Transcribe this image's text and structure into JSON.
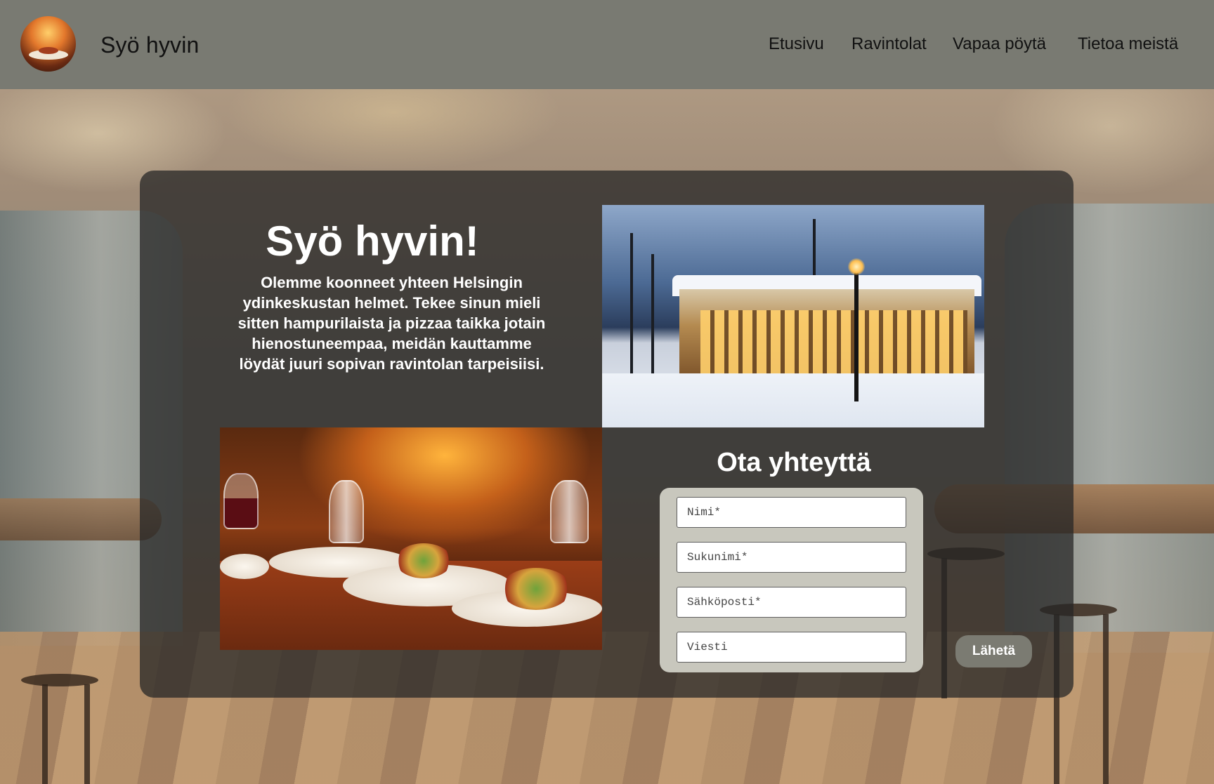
{
  "header": {
    "brand": "Syö hyvin",
    "nav": [
      {
        "label": "Etusivu"
      },
      {
        "label": "Ravintolat"
      },
      {
        "label": "Vapaa pöytä"
      },
      {
        "label": "Tietoa meistä"
      }
    ]
  },
  "hero": {
    "title": "Syö hyvin!",
    "text": "Olemme koonneet yhteen Helsingin ydinkeskustan helmet. Tekee sinun mieli sitten hampurilaista ja pizzaa taikka jotain hienostuneempaa, meidän kauttamme löydät juuri sopivan ravintolan tarpeisiisi."
  },
  "contact": {
    "title": "Ota yhteyttä",
    "fields": {
      "first_name": "Nimi*",
      "last_name": "Sukunimi*",
      "email": "Sähköposti*",
      "message": "Viesti"
    },
    "submit_label": "Lähetä"
  },
  "colors": {
    "header_bg": "#797a72",
    "panel_bg": "#262626",
    "form_bg": "#c8c7bd",
    "button_bg": "#7b7b72"
  }
}
